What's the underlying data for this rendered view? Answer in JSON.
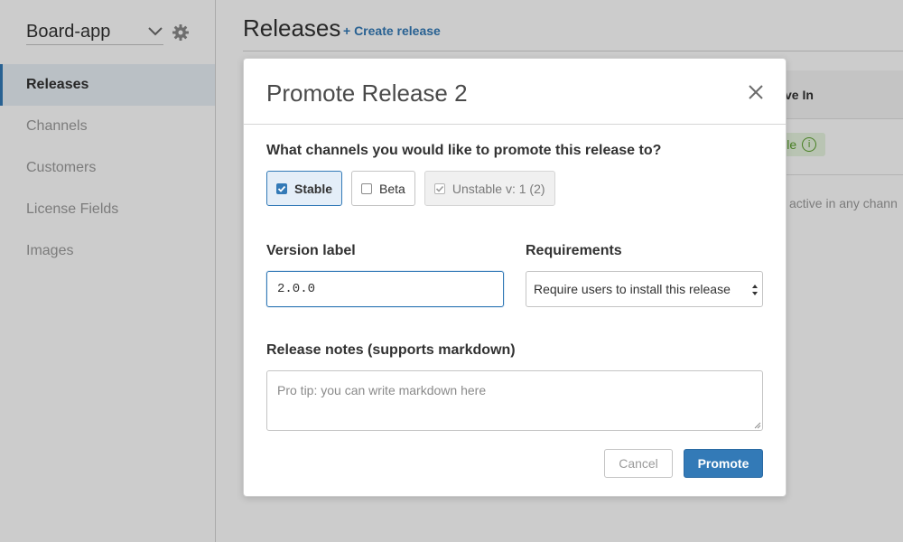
{
  "sidebar": {
    "app_name": "Board-app",
    "items": [
      {
        "label": "Releases",
        "active": true
      },
      {
        "label": "Channels",
        "active": false
      },
      {
        "label": "Customers",
        "active": false
      },
      {
        "label": "License Fields",
        "active": false
      },
      {
        "label": "Images",
        "active": false
      }
    ]
  },
  "main": {
    "title": "Releases",
    "create_link": "+ Create release",
    "column_head": "ve In",
    "channel_chip": "nstable",
    "chip_info": "i",
    "inactive_text": "active in any chann"
  },
  "modal": {
    "title": "Promote Release 2",
    "question": "What channels you would like to promote this release to?",
    "channels": [
      {
        "label": "Stable",
        "checked": true,
        "state": "selected"
      },
      {
        "label": "Beta",
        "checked": false,
        "state": "normal"
      },
      {
        "label": "Unstable v: 1 (2)",
        "checked": true,
        "state": "disabled"
      }
    ],
    "version_label": "Version label",
    "version_value": "2.0.0",
    "requirements_label": "Requirements",
    "requirements_value": "Require users to install this release",
    "notes_label": "Release notes (supports markdown)",
    "notes_placeholder": "Pro tip: you can write markdown here",
    "cancel_label": "Cancel",
    "promote_label": "Promote"
  },
  "colors": {
    "accent": "#337ab7",
    "active_nav_bg": "#e9f0f7",
    "chip_green": "#5aa02c",
    "overlay": "rgba(0,0,0,0.2)"
  },
  "icons": {
    "settings": "gear-icon",
    "app_dropdown": "chevron-down-icon",
    "close": "close-icon",
    "check": "check-icon",
    "select_arrows": "select-arrows-icon",
    "info": "info-icon"
  }
}
